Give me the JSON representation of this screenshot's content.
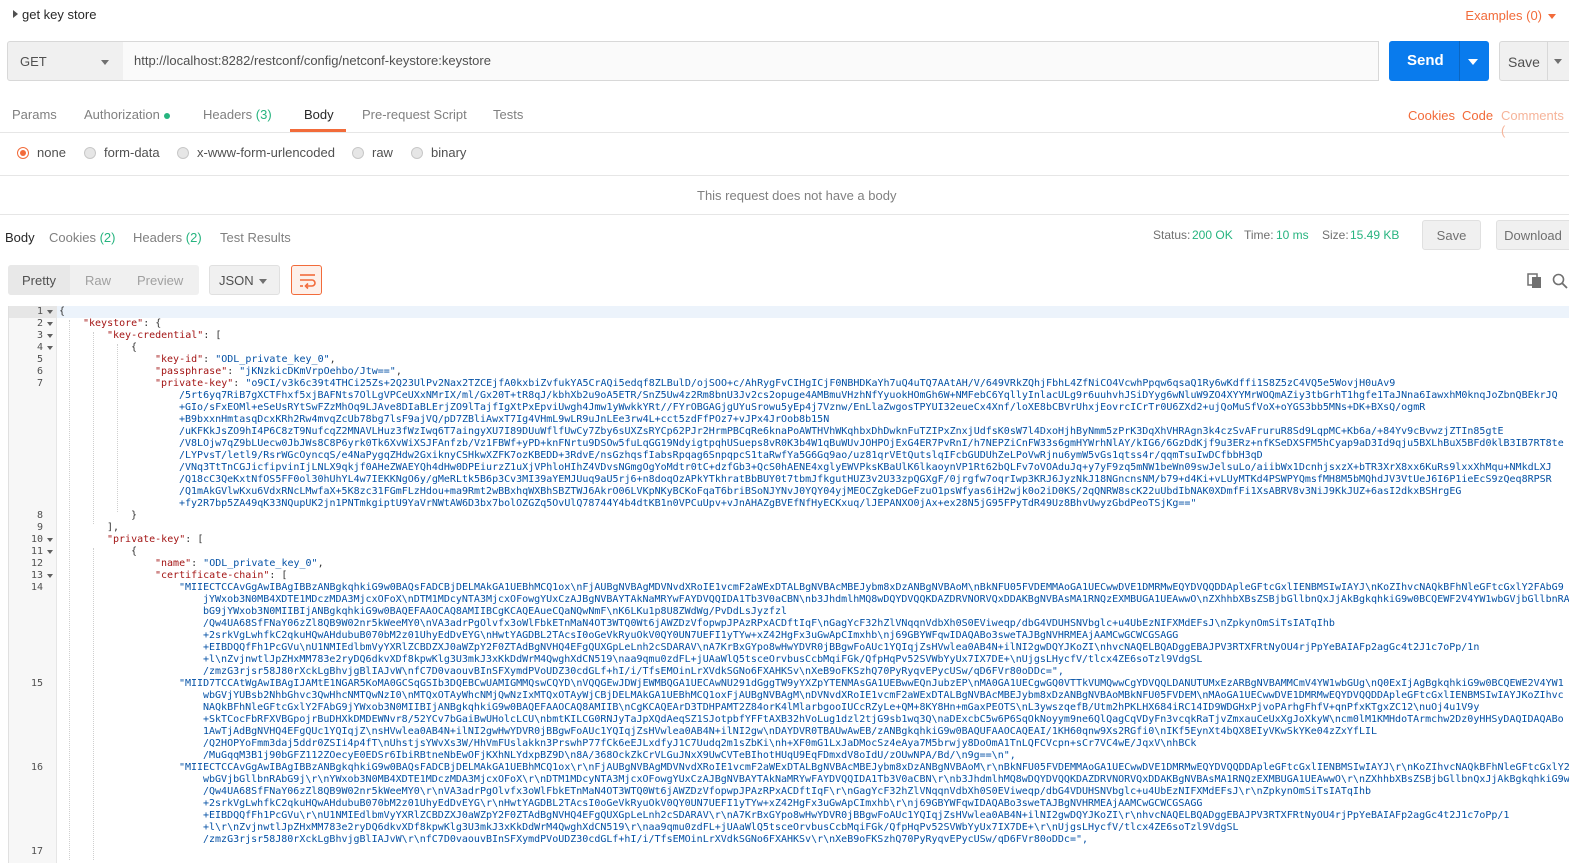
{
  "request": {
    "name": "get key store",
    "examples_label": "Examples (0)",
    "method": "GET",
    "url": "http://localhost:8282/restconf/config/netconf-keystore:keystore",
    "send_label": "Send",
    "save_label": "Save"
  },
  "request_tabs": {
    "params": "Params",
    "authorization": "Authorization",
    "headers": "Headers",
    "headers_count": "(3)",
    "body": "Body",
    "prerequest": "Pre-request Script",
    "tests": "Tests"
  },
  "request_links": {
    "cookies": "Cookies",
    "code": "Code",
    "comments": "Comments ("
  },
  "body_types": {
    "none": "none",
    "form_data": "form-data",
    "urlencoded": "x-www-form-urlencoded",
    "raw": "raw",
    "binary": "binary",
    "selected": "none"
  },
  "no_body_message": "This request does not have a body",
  "response_tabs": {
    "body": "Body",
    "cookies": "Cookies",
    "cookies_count": "(2)",
    "headers": "Headers",
    "headers_count": "(2)",
    "test_results": "Test Results"
  },
  "response_meta": {
    "status_label": "Status:",
    "status_value": "200 OK",
    "time_label": "Time:",
    "time_value": "10 ms",
    "size_label": "Size:",
    "size_value": "15.49 KB",
    "save_label": "Save",
    "download_label": "Download"
  },
  "response_toolbar": {
    "pretty": "Pretty",
    "raw": "Raw",
    "preview": "Preview",
    "language": "JSON"
  },
  "colors": {
    "accent": "#f26b3a",
    "send_blue": "#097bed",
    "status_green": "#26b47f",
    "json_key": "#a31515",
    "json_string": "#0451a5"
  },
  "icons": {
    "copy": "copy-icon",
    "search": "search-icon",
    "wrap": "wrap-lines-icon"
  },
  "code": {
    "line_numbers": [
      "1",
      "2",
      "3",
      "4",
      "5",
      "6",
      "7",
      "8",
      "9",
      "10",
      "11",
      "12",
      "13",
      "14",
      "15",
      "16",
      "17"
    ],
    "l1": "{",
    "l2_key": "\"keystore\"",
    "l2_rest": ": {",
    "l3_key": "\"key-credential\"",
    "l3_rest": ": [",
    "l4": "{",
    "l5_key": "\"key-id\"",
    "l5_val": "\"ODL_private_key_0\"",
    "l6_key": "\"passphrase\"",
    "l6_val": "\"jKNzkicDKmVrpOehbo/Jtw==\"",
    "l7_key": "\"private-key\"",
    "l7_val": [
      "\"o9CI/v3k6c39t4THCi25Zs+2Q23UlPv2Nax2TZCEjfA0kxbiZvfukYA5CrAQi5edqf8ZLBulD/ojSOO+c/AhRygFvCIHgICjF0NBHDKaYh7uQ4uTQ7AAtAH/V/649VRkZQhjFbhL4ZfNiCO4VcwhPpqw6qsaQ1Ry6wKdffi1S8Z5zC4VQ5e5WovjH0uAv9",
      "/5rt6yq7RiB7gXCTFhxf5xjBAFNts7OlLgVPCeUXxNMrIX/ml/Gx20T+tR8qJ/kbhXb2u9oA5ETR/SnZ5Uw4z2Rm8bnU3Jv2cs2opuge4AMBmuVHzhNfYyuokHOmGh6W+NMFebC6YqllyInlacULg9r6uuhvhJSiDYyg6wNluW9ZO4XYYMrWOQmAZiy3tbGrhT1hgfe1TaJNna6IawxhM0knqJoZbnQBEkrJQ",
      "+GIo/sFxEOMl+eSeUsRYtSwFZzMhOq9LJAve8DIaBLErjZO9lTajfIgXtPxEpviUwgh4Jmw1yWwkkYRt//FYrOBGAGjgUYuSrowu5yEp4j7Vznw/EnLlaZwgosTPYUI32eueCx4Xnf/loXE8bCBVrUhxjEovrcICrTr0U6ZXd2+ujQoMuSfVoX+oYGS3bb5MNs+DK+BXsQ/ogmR",
      "+B9bxxnHmtasqDcxKRh2Rw4mvqZcUb78bg7lsF9ajVQ/pD7ZBliAwxT7Ig4VHmL9wLR9uJnLEe3rw4L+cct5zdFfPOz7+vJPx4JrOob8b15N",
      "/uKFKkJsZO9hI4P6C8zT9NufcqZ2MNAVLHuz3fWzIwq6T7aingyXU7I89DUuWflfUwCy7Zby6sUXZsRYCp62PJr2HrmPBCqRe6knaPoAWTHVhWKqhbxDhDwknFuTZIPxZnxjUdfsK0sW7l4DxoHjhByNmm5zPrK3DqXhVHRAgn3k4czSvAFruruR8Sd9LqpMC+Kb6a/+84Yv9cBvwzjZTIn85gtE",
      "/V8LOjw7qZ9bLUecw0JbJWs8C8P6yrk0Tk6XvWiXSJFAnfzb/Vz1FBWf+yPD+knFNrtu9DSOw5fuLqGG19NdyigtpqhUSueps8vR0K3b4W1qBuWUvJOHPOjExG4ER7PvRnI/h7NEPZiCnFW33s6gmHYWrhNlAY/kIG6/6GzDdKjf9u3ERz+nfKSeDXSFM5hCyap9aD3Id9qju5BXLhBuX5BFd0klB3IB7RT8te",
      "/LYPvsT/letl9/RsrWGcOyncqS/e4NaPygqZHdw2GxiknyCSHkwXZFK7ozKBEDD+3RdvE/nsGzhqsfIabsRpqag6SnpqpcS1taRwfYa5G6Gq9ao/uz81qrVEtQutslqIFcbGUDUhZeLPoVwRjnu6ymW5vGs1qtss4r/qqmTsuIwDCfbbH3qD",
      "/VNq3TtTnCGJicfipvinIjLNLX9qkjf0AHeZWAEYQh4dHw0DPEiurzZ1uXjVPhloHIhZ4VDvsNGmgOgYoMdtr0tC+dzfGb3+QcS0hAENE4xglyEWVPksKBaUlK6lkaoynVP1Rt62bQLFv7oVOAduJq+y7yF9zq5mNW1beWn09swJelsuLo/aiibWx1DcnhjsxzX+bTR3XrX8xx6KuRs9lxxXhMqu+NMkdLXJ",
      "/Q18cC3QeKxtNfOS5FF0ol30hUhYL4w7IEKKNgO6y/gMeRLtk5B6p3Cv3MI39aYEMJUuq9aU5rj6+n8doqOzAPkYTkhratBbBUY0t7tbmJfkgutHUZ3v2U33zpQGXgF/0jrgfw7oqrIwp3KRJ6JyzNkJ18NGncnsNM/b79+d4Ki+vLUyMTKd4PSWPYQmsfMH8M5bMQhdJV3VtUeJ6I6P1ieEcS9zQeq8RPSR",
      "/Q1mAkGVlwKxu6VdxRNcLMwfaX+5K8zc31FGmFLzHdou+ma9Rmt2wBBxhqWXBhSBZTWJ6AkrO06LVKpNKyBCKoFqaT6briBSoNJYNvJ0YQY04yjMEOCZgkeDGeFzuO1psWfyas6iH2wjk0o2iD0KS/2qQNRW8scK22uUbdIbNAK0XDmfFi1XsABRV8v3NiJ9KkJUZ+6asI2dkxBSHrgEG",
      "+fy2R7bp5ZA49qK33NQupUK2jn1PNTmkgiptU9YaVrNWtAW6D3bx7bolOZGZq5OvUlQ78744Y4b4dtKB1n0VPCuUpv+vJnAHAZgBVEfNfHyECKxuq/lJEPANXO0jAx+ex28N5jG95FPyTdR49Uz8BhvUwyzGbdPeoTSjKg==\""
    ],
    "l8": "}",
    "l9": "],",
    "l10_key": "\"private-key\"",
    "l10_rest": ": [",
    "l11": "{",
    "l12_key": "\"name\"",
    "l12_val": "\"ODL_private_key_0\"",
    "l13_key": "\"certificate-chain\"",
    "l13_rest": ": [",
    "l14_val": [
      "\"MIIECTCCAvGgAwIBAgIBBzANBgkqhkiG9w0BAQsFADCBjDELMAkGA1UEBhMCQ1ox\\nFjAUBgNVBAgMDVNvdXRoIE1vcmF2aWExDTALBgNVBAcMBEJybm8xDzANBgNVBAoM\\nBkNFU05FVDEMMAoGA1UECwwDVE1DMRMwEQYDVQQDDApleGFtcGxlIENBMSIwIAYJ\\nKoZIhvcNAQkBFhNleGFtcGxlY2FAbG9",
      "jYWxob3N0MB4XDTE1MDczMDA3MjcxOFoX\\nDTM1MDcyNTA3MjcxOFowgYUxCzAJBgNVBAYTAkNaMRYwFAYDVQQIDA1Tb3V0aCBN\\nb3JhdmlhMQ8wDQYDVQQKDAZDRVNORVQxDDAKBgNVBAsMA1RNQzEXMBUGA1UEAwwO\\nZXhhbXBsZSBjbGllbnQxJjAkBgkqhkiG9w0BCQEWF2V4YW1wbGVjbGllbnRA",
      "bG9jYWxob3N0MIIBIjANBgkqhkiG9w0BAQEFAAOCAQ8AMIIBCgKCAQEAueCQaNQwNmF\\nK6LKu1p8U8ZWdWg/PvDdLsJyzfzl",
      "/Qw4UA68SfFNaY06zZl8QB9W02nr5kWeeMY0\\nVA3adrPgOlvfx3oWlFbkETnMaN4OT3WTQ0Wt6jAWZDzVfopwpJPAzRPxACDftIqF\\nGagYcF32hZlVNqqnVdbXh0S0EViweqp/dbG4VDUHSNVbglc+u4UbEzNIFXMdEFsJ\\nZpkynOmSiTsIATqIhb",
      "+2srkVgLwhfkC2qkuHQwAHdubuB070bM2z01UhyEdDvEYG\\nHwtYAGDBL2TAcsI0oGeVkRyuOkV0QY0UN7UEFI1yTYw+xZ42HgFx3uGwApCImxhb\\nj69GBYWFqwIDAQABo3sweTAJBgNVHRMEAjAAMCwGCWCGSAGG",
      "+EIBDQQfFh1PcGVu\\nU1NMIEdlbmVyYXRlZCBDZXJ0aWZpY2F0ZTAdBgNVHQ4EFgQUXGpLeLnh2cSDARAV\\nA7KrBxGYpo8wHwYDVR0jBBgwFoAUc1YQIqjZsHVwlea0AB4N+ilNI2gwDQYJKoZI\\nhvcNAQELBQADggEBAJPV3RTXFRtNyOU4rjPpYeBAIAFp2agGc4t2J1c7oPp/1n",
      "+l\\nZvjnwtlJpZHxMM783e2ryDQ6dkvXDf8kpwKlg3U3mkJ3xKkDdWrM4QwghXdCN519\\naa9qmu0zdFL+jUAaWlQ5tsceOrvbusCcbMqiFGk/QfpHqPv52SVWbYyUx7IX7DE+\\nUjgsLHycfV/tlcx4ZE6soTzl9VdgSL",
      "/zmzG3rjsr58J80rXckLgBhvjgBlIAJvW\\nfC7D0vaouvBInSFXymdPVoUDZ30cdGLf+hI/i/TfsEMOinLrXVdkSGNo6FXAHKSv\\nXeB9oFKSzhQ70PyRyqvEPycUSw/qD6FVr80oDDc=\","
    ],
    "l15_val": [
      "\"MIID7TCCAtWgAwIBAgIJAMtE1NGAR5KoMA0GCSqGSIb3DQEBCwUAMIGMMQswCQYD\\nVQQGEwJDWjEWMBQGA1UECAwNU291dGggTW9yYXZpYTENMAsGA1UEBwwEQnJubzEP\\nMA0GA1UECgwGQ0VTTkVUMQwwCgYDVQQLDANUTUMxEzARBgNVBAMMCmV4YW1wbGUg\\nQ0ExIjAgBgkqhkiG9w0BCQEWE2V4YW1",
      "wbGVjYUBsb2NhbGhvc3QwHhcNMTQwNzI0\\nMTQxOTAyWhcNMjQwNzIxMTQxOTAyWjCBjDELMAkGA1UEBhMCQ1oxFjAUBgNVBAgM\\nDVNvdXRoIE1vcmF2aWExDTALBgNVBAcMBEJybm8xDzANBgNVBAoMBkNFU05FVDEM\\nMAoGA1UECwwDVE1DMRMwEQYDVQQDDApleGFtcGxlIENBMSIwIAYJKoZIhvc",
      "NAQkBFhNleGFtcGxlY2FAbG9jYWxob3N0MIIBIjANBgkqhkiG9w0BAQEFAAOCAQ8AMIIB\\nCgKCAQEArD3TDHPAMT2Z84orK4lMlarbgooIUCcRZyLe+QM+8KY8Hn+mGaxPEOTS\\nL3ywszqefB/Utm2hPKLHX684iRC14ID9WDGHxPjvoPArhgFhfV+qnPfxKTgxZC12\\nuOj4u1V9y",
      "+SkTCocFbRFXVBGpojrBuDHXkDMDEWNvr8/52YCv7bGaiBwUHolcLCU\\nbmtKILCG0RNJyTaJpXQdAeqSZ1SJotpbfYFFtAXB32hVoLug1dzl2tjG9sb1wq3Q\\naDExcbC5w6P6SqOkNoyym9ne6QlQagCqVDyFn3vcqkRaTjvZmxauCeUxXgJoXkyW\\ncm0lM1KMHdoTArmchw2Dz0yHHSyDAQIDAQABo",
      "1AwTjAdBgNVHQ4EFgQUc1YQIqjZ\\nsHVwlea0AB4N+ilNI2gwHwYDVR0jBBgwFoAUc1YQIqjZsHVwlea0AB4N+ilNI2gw\\nDAYDVR0TBAUwAwEB/zANBgkqhkiG9w0BAQUFAAOCAQEAI/1KH60qnw9Xs2RGfi0\\nIKf5EynXt4bQX8EIyVKwSkYKe04zZxYfLIL",
      "/Q2HOPYoFmm3daj5ddr0ZSIi4p4fT\\nUhstjsYWvXs3W/HhVmFUslakkn3PrswhP77fCk6eEJLxdfyJ1C7Uudq2m1sZbKi\\nh+XF0mG1LxJaDMocSz4eAya7M5brwjy8DoOmA1TnLQFCVcpn+sCr7VC4wE/JqxV\\nhBCk",
      "/MuGqqM3B1j90bGFZ112ZOecyE0EDSr6IbiRBtneNbEwOFjKXhNLYdxpBZ9D\\n8A/368OckZkCrVLGuJNxX9UwCVTeBIhotHUqU9EqFDmxdV8oIdU/zOUwNPA/Bd/\\n9g==\\n\","
    ],
    "l16_val": [
      "\"MIIECTCCAvGgAwIBAgIBBzANBgkqhkiG9w0BAQsFADCBjDELMAkGA1UEBhMCQ1ox\\r\\nFjAUBgNVBAgMDVNvdXRoIE1vcmF2aWExDTALBgNVBAcMBEJybm8xDzANBgNVBAoM\\r\\nBkNFU05FVDEMMAoGA1UECwwDVE1DMRMwEQYDVQQDDApleGFtcGxlIENBMSIwIAYJ\\r\\nKoZIhvcNAQkBFhNleGFtcGxlY2FAbG9",
      "wbGVjbGllbnRAbG9j\\r\\nYWxob3N0MB4XDTE1MDczMDA3MjcxOFoX\\r\\nDTM1MDcyNTA3MjcxOFowgYUxCzAJBgNVBAYTAkNaMRYwFAYDVQQIDA1Tb3V0aCBN\\r\\nb3JhdmlhMQ8wDQYDVQQKDAZDRVNORVQxDDAKBgNVBAsMA1RNQzEXMBUGA1UEAwwO\\r\\nZXhhbXBsZSBjbGllbnQxJjAkBgkqhkiG9w0BCQEWF2V4YW1",
      "/Qw4UA68SfFNaY06zZl8QB9W02nr5kWeeMY0\\r\\nVA3adrPgOlvfx3oWlFbkETnMaN4OT3WTQ0Wt6jAWZDzVfopwpJPAzRPxACDftIqF\\r\\nGagYcF32hZlVNqqnVdbXh0S0EViweqp/dbG4VDUHSNVbglc+u4UbEzNIFXMdEFsJ\\r\\nZpkynOmSiTsIATqIhb",
      "+2srkVgLwhfkC2qkuHQwAHdubuB070bM2z01UhyEdDvEYG\\r\\nHwtYAGDBL2TAcsI0oGeVkRyuOkV0QY0UN7UEFI1yTYw+xZ42HgFx3uGwApCImxhb\\r\\nj69GBYWFqwIDAQABo3sweTAJBgNVHRMEAjAAMCwGCWCGSAGG",
      "+EIBDQQfFh1PcGVu\\r\\nU1NMIEdlbmVyYXRlZCBDZXJ0aWZpY2F0ZTAdBgNVHQ4EFgQUXGpLeLnh2cSDARAV\\r\\nA7KrBxGYpo8wHwYDVR0jBBgwFoAUc1YQIqjZsHVwlea0AB4N+ilNI2gwDQYJKoZI\\r\\nhvcNAQELBQADggEBAJPV3RTXFRtNyOU4rjPpYeBAIAFp2agGc4t2J1c7oPp/1",
      "+l\\r\\nZvjnwtlJpZHxMM783e2ryDQ6dkvXDf8kpwKlg3U3mkJ3xKkDdWrM4QwghXdCN519\\r\\naa9qmu0zdFL+jUAaWlQ5tsceOrvbusCcbMqiFGk/QfpHqPv52SVWbYyUx7IX7DE+\\r\\nUjgsLHycfV/tlcx4ZE6soTzl9VdgSL",
      "/zmzG3rjsr58J80rXckLgBhvjgBlIAJvW\\r\\nfC7D0vaouvBInSFXymdPVoUDZ30cdGLf+hI/i/TfsEMOinLrXVdkSGNo6FXAHKSv\\r\\nXeB9oFKSzhQ70PyRyqvEPycUSw/qD6FVr80oDDc=\","
    ]
  }
}
